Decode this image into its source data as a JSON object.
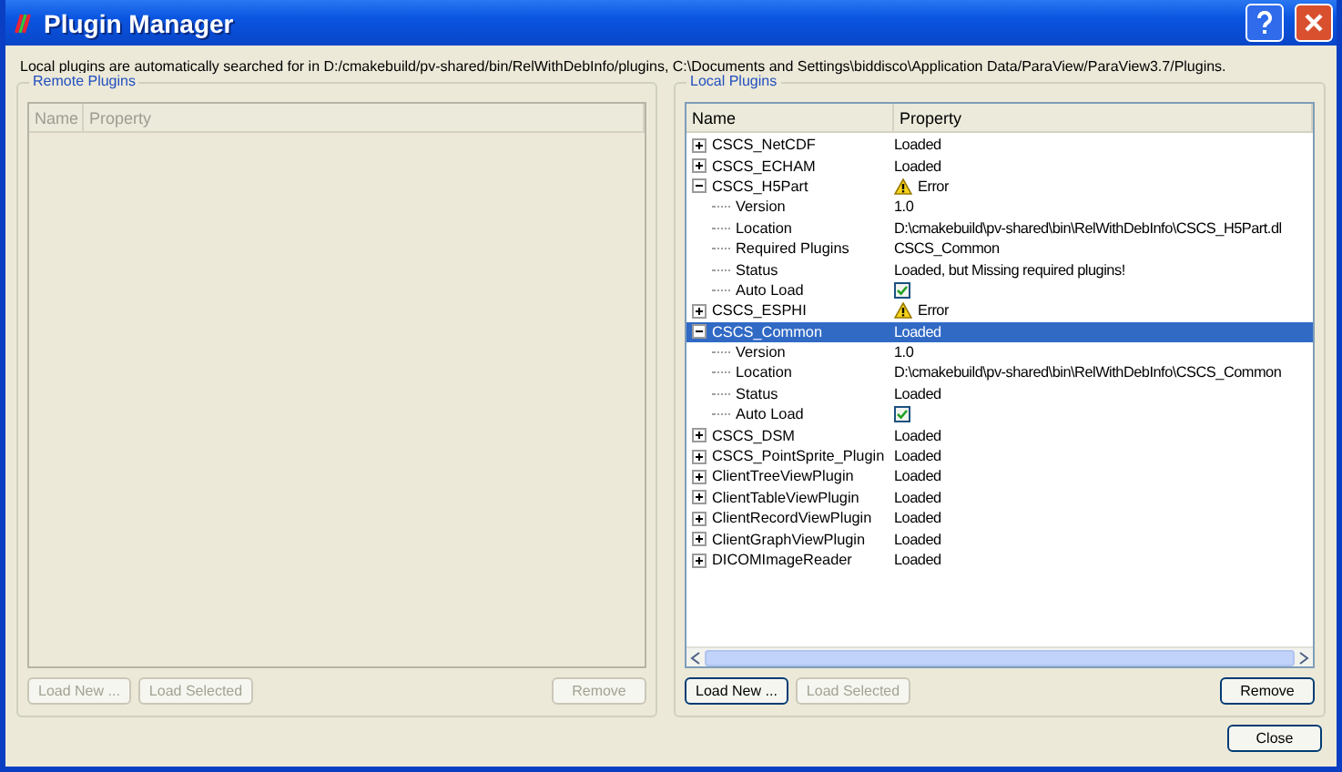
{
  "window": {
    "title": "Plugin Manager"
  },
  "info": "Local plugins are automatically searched for in D:/cmakebuild/pv-shared/bin/RelWithDebInfo/plugins, C:\\Documents and Settings\\biddisco\\Application Data/ParaView/ParaView3.7/Plugins.",
  "remote_plugins": {
    "title": "Remote Plugins",
    "columns": [
      "Name",
      "Property"
    ],
    "buttons": [
      {
        "label": "Load New ...",
        "disabled": true,
        "kind": "left"
      },
      {
        "label": "Load Selected",
        "disabled": true,
        "kind": "left"
      },
      {
        "label": "Remove",
        "disabled": true,
        "kind": "right"
      }
    ]
  },
  "local_plugins": {
    "title": "Local Plugins",
    "columns": [
      "Name",
      "Property"
    ],
    "tree": [
      {
        "name": "CSCS_NetCDF",
        "property": "Loaded",
        "kind": "ok",
        "expanded": false,
        "selected": false
      },
      {
        "name": "CSCS_ECHAM",
        "property": "Loaded",
        "kind": "ok",
        "expanded": false,
        "selected": false
      },
      {
        "name": "CSCS_H5Part",
        "property": "Error",
        "kind": "error",
        "expanded": true,
        "selected": false,
        "children": [
          {
            "name": "Version",
            "property": "1.0",
            "kind": "text"
          },
          {
            "name": "Location",
            "property": "D:\\cmakebuild\\pv-shared\\bin\\RelWithDebInfo\\CSCS_H5Part.dl",
            "kind": "text"
          },
          {
            "name": "Required Plugins",
            "property": "CSCS_Common",
            "kind": "text"
          },
          {
            "name": "Status",
            "property": "Loaded, but Missing required plugins!",
            "kind": "text"
          },
          {
            "name": "Auto Load",
            "checked": true,
            "kind": "checkbox"
          }
        ]
      },
      {
        "name": "CSCS_ESPHI",
        "property": "Error",
        "kind": "error",
        "expanded": false,
        "selected": false
      },
      {
        "name": "CSCS_Common",
        "property": "Loaded",
        "kind": "ok",
        "expanded": true,
        "selected": true,
        "children": [
          {
            "name": "Version",
            "property": "1.0",
            "kind": "text"
          },
          {
            "name": "Location",
            "property": "D:\\cmakebuild\\pv-shared\\bin\\RelWithDebInfo\\CSCS_Common",
            "kind": "text"
          },
          {
            "name": "Status",
            "property": "Loaded",
            "kind": "text"
          },
          {
            "name": "Auto Load",
            "checked": true,
            "kind": "checkbox"
          }
        ]
      },
      {
        "name": "CSCS_DSM",
        "property": "Loaded",
        "kind": "ok",
        "expanded": false,
        "selected": false
      },
      {
        "name": "CSCS_PointSprite_Plugin",
        "property": "Loaded",
        "kind": "ok",
        "expanded": false,
        "selected": false
      },
      {
        "name": "ClientTreeViewPlugin",
        "property": "Loaded",
        "kind": "ok",
        "expanded": false,
        "selected": false
      },
      {
        "name": "ClientTableViewPlugin",
        "property": "Loaded",
        "kind": "ok",
        "expanded": false,
        "selected": false
      },
      {
        "name": "ClientRecordViewPlugin",
        "property": "Loaded",
        "kind": "ok",
        "expanded": false,
        "selected": false
      },
      {
        "name": "ClientGraphViewPlugin",
        "property": "Loaded",
        "kind": "ok",
        "expanded": false,
        "selected": false
      },
      {
        "name": "DICOMImageReader",
        "property": "Loaded",
        "kind": "ok",
        "expanded": false,
        "selected": false
      }
    ],
    "buttons": [
      {
        "label": "Load New ...",
        "disabled": false,
        "kind": "left"
      },
      {
        "label": "Load Selected",
        "disabled": true,
        "kind": "left"
      },
      {
        "label": "Remove",
        "disabled": false,
        "kind": "right"
      }
    ]
  },
  "footer_buttons": [
    {
      "label": "Close",
      "disabled": false
    }
  ]
}
